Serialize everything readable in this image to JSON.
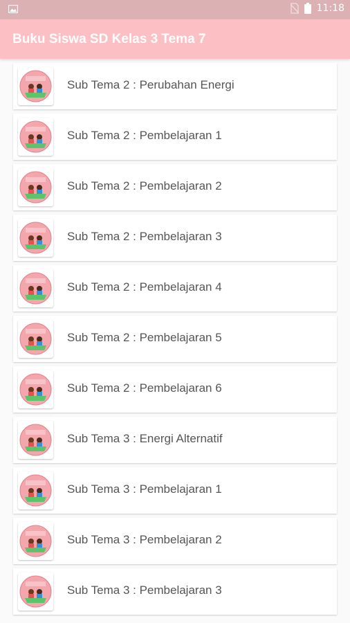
{
  "status_bar": {
    "time": "11:18"
  },
  "app_bar": {
    "title": "Buku Siswa SD Kelas 3 Tema 7"
  },
  "list": {
    "items": [
      {
        "label": "Sub Tema 2 : Perubahan Energi"
      },
      {
        "label": "Sub Tema 2 : Pembelajaran 1"
      },
      {
        "label": "Sub Tema 2 : Pembelajaran 2"
      },
      {
        "label": "Sub Tema 2 : Pembelajaran 3"
      },
      {
        "label": "Sub Tema 2 : Pembelajaran 4"
      },
      {
        "label": "Sub Tema 2 : Pembelajaran 5"
      },
      {
        "label": "Sub Tema 2 : Pembelajaran 6"
      },
      {
        "label": "Sub Tema 3 : Energi Alternatif"
      },
      {
        "label": "Sub Tema 3 : Pembelajaran 1"
      },
      {
        "label": "Sub Tema 3 : Pembelajaran 2"
      },
      {
        "label": "Sub Tema 3 : Pembelajaran 3"
      }
    ]
  },
  "colors": {
    "status_bar": "#dcb1b4",
    "app_bar": "#fcc0c4",
    "background": "#fafafa"
  }
}
